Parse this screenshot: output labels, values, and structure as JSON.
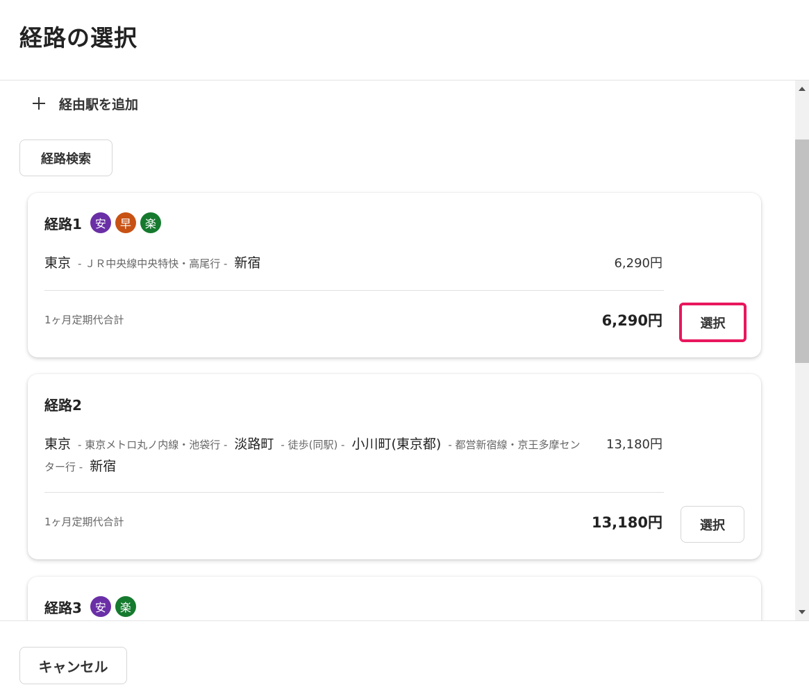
{
  "dialog": {
    "title": "経路の選択"
  },
  "add_via": {
    "label": "経由駅を追加",
    "icon": "plus-icon"
  },
  "search_button": {
    "label": "経路検索"
  },
  "routes": [
    {
      "title": "経路1",
      "badges": [
        {
          "label": "安",
          "color": "#6a2fa6"
        },
        {
          "label": "早",
          "color": "#c85214"
        },
        {
          "label": "楽",
          "color": "#157a2e"
        }
      ],
      "path": [
        {
          "kind": "station",
          "text": "東京"
        },
        {
          "kind": "line",
          "text": "- ＪＲ中央線中央特快・高尾行 -"
        },
        {
          "kind": "station",
          "text": "新宿"
        }
      ],
      "price": "6,290円",
      "total_label": "1ヶ月定期代合計",
      "total_value": "6,290円",
      "select_label": "選択",
      "highlighted": true,
      "highlight_color": "#e8175d"
    },
    {
      "title": "経路2",
      "badges": [],
      "path": [
        {
          "kind": "station",
          "text": "東京"
        },
        {
          "kind": "line",
          "text": "- 東京メトロ丸ノ内線・池袋行 -"
        },
        {
          "kind": "station",
          "text": "淡路町"
        },
        {
          "kind": "line",
          "text": "- 徒歩(同駅) -"
        },
        {
          "kind": "station",
          "text": "小川町(東京都)"
        },
        {
          "kind": "line",
          "text": "- 都営新宿線・京王多摩センター行 -"
        },
        {
          "kind": "station",
          "text": "新宿"
        }
      ],
      "price": "13,180円",
      "total_label": "1ヶ月定期代合計",
      "total_value": "13,180円",
      "select_label": "選択",
      "highlighted": false
    },
    {
      "title": "経路3",
      "badges": [
        {
          "label": "安",
          "color": "#6a2fa6"
        },
        {
          "label": "楽",
          "color": "#157a2e"
        }
      ]
    }
  ],
  "footer": {
    "cancel_label": "キャンセル"
  }
}
